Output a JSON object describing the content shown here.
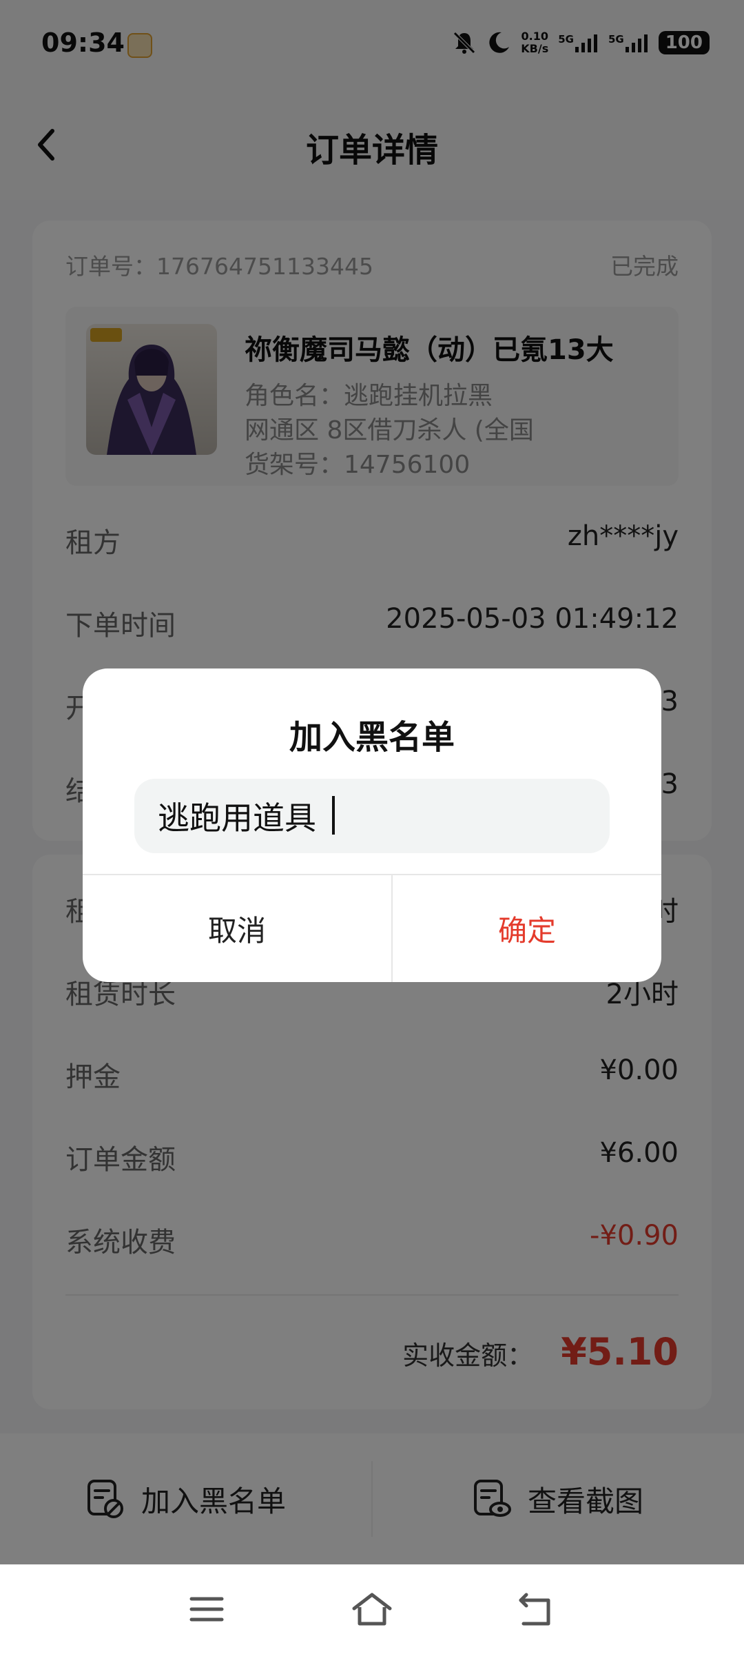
{
  "status_bar": {
    "time": "09:34",
    "net_speed_value": "0.10",
    "net_speed_unit": "KB/s",
    "signal1_label": "5G",
    "signal2_label": "5G",
    "battery": "100"
  },
  "header": {
    "title": "订单详情"
  },
  "order": {
    "number": "订单号：176764751133445",
    "status": "已完成",
    "product": {
      "title": "祢衡魔司马懿（动）已氪13大",
      "role": "角色名：逃跑挂机拉黑",
      "server": "网通区  8区借刀杀人 (全国",
      "shelf": "货架号：14756100"
    },
    "rows": [
      {
        "label": "租方",
        "value": "zh****jy"
      },
      {
        "label": "下单时间",
        "value": "2025-05-03 01:49:12"
      },
      {
        "label": "开",
        "value": "3"
      },
      {
        "label": "结",
        "value": "3"
      }
    ]
  },
  "fees": {
    "rows": [
      {
        "label": "租",
        "value": "时"
      },
      {
        "label": "租赁时长",
        "value": "2小时"
      },
      {
        "label": "押金",
        "value": "¥0.00"
      },
      {
        "label": "订单金额",
        "value": "¥6.00"
      },
      {
        "label": "系统收费",
        "value": "-¥0.90"
      }
    ],
    "total_label": "实收金额：",
    "total_value": "¥5.10"
  },
  "actions": {
    "blacklist_label": "加入黑名单",
    "screenshot_label": "查看截图"
  },
  "dialog": {
    "title": "加入黑名单",
    "input_value": "逃跑用道具",
    "cancel_label": "取消",
    "confirm_label": "确定"
  },
  "colors": {
    "accent_red": "#e43b2c",
    "overlay": "rgba(0,0,0,0.5)"
  },
  "icons": [
    "back-arrow-icon",
    "mute-icon",
    "moon-icon",
    "signal-icon",
    "battery-icon",
    "blacklist-icon",
    "screenshot-icon",
    "menu-icon",
    "home-icon",
    "return-icon"
  ]
}
